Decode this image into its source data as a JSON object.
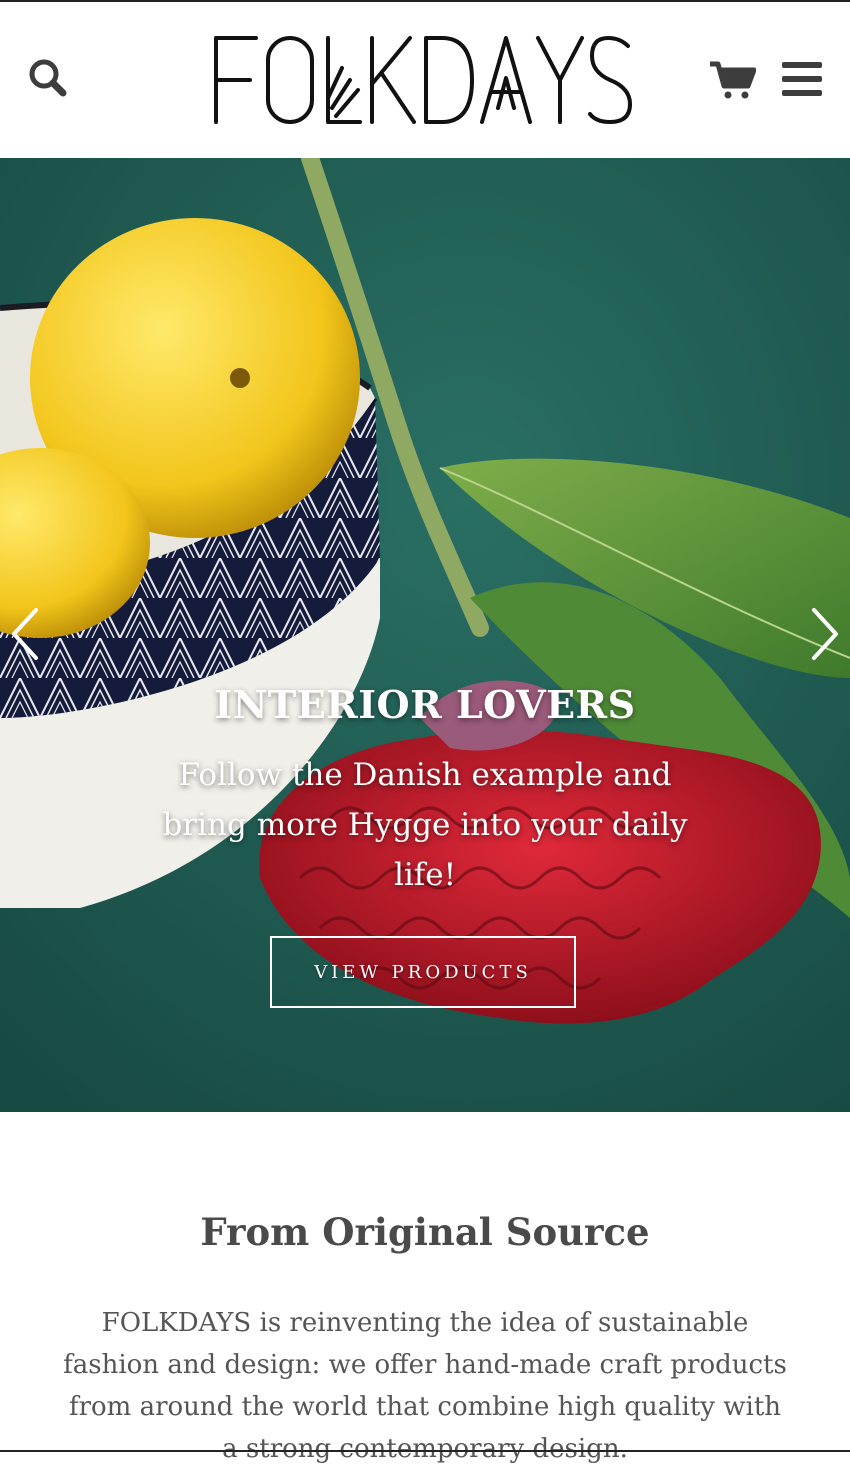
{
  "header": {
    "logo_text": "FOLKDAYS",
    "search_icon": "search-icon",
    "cart_icon": "cart-icon",
    "menu_icon": "hamburger-menu-icon"
  },
  "hero": {
    "title": "INTERIOR LOVERS",
    "subtitle": "Follow the Danish example and bring more Hygge into your daily life!",
    "cta_label": "VIEW PRODUCTS",
    "prev_icon": "chevron-left-icon",
    "next_icon": "chevron-right-icon"
  },
  "intro": {
    "title": "From Original Source",
    "text": "FOLKDAYS is reinventing the idea of sustainable fashion and design: we offer hand-made craft products from around the world that combine high quality with a strong contemporary design."
  },
  "colors": {
    "hero_background": "#1f5c52",
    "text_dark": "#4a4a4a",
    "accent_white": "#ffffff"
  }
}
